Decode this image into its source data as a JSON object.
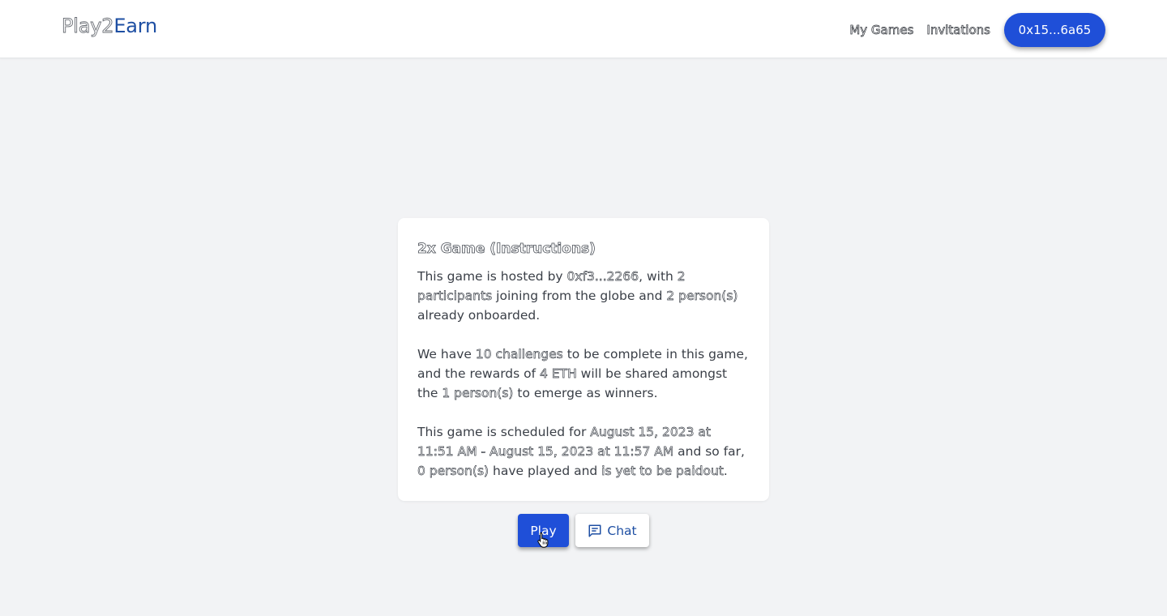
{
  "header": {
    "brand_part1": "Play2",
    "brand_part2": "Earn",
    "nav_links": [
      "My Games",
      "Invitations"
    ],
    "wallet_address": "0x15...6a65"
  },
  "card": {
    "title": "2x Game (Instructions)",
    "p1": {
      "t1": "This game is hosted by ",
      "host": "0xf3...2266",
      "t2": ", with ",
      "participants": "2 participants",
      "t3": " joining from the globe and ",
      "onboarded": "2 person(s)",
      "t4": " already onboarded."
    },
    "p2": {
      "t1": "We have ",
      "challenges": "10 challenges",
      "t2": " to be complete in this game, and the rewards of ",
      "reward": "4 ETH",
      "t3": " will be shared amongst the ",
      "winners": "1 person(s)",
      "t4": " to emerge as winners."
    },
    "p3": {
      "t1": "This game is scheduled for ",
      "schedule": "August 15, 2023 at 11:51 AM - August 15, 2023 at 11:57 AM",
      "t2": " and so far, ",
      "played": "0 person(s)",
      "t3": " have played and ",
      "status": "is yet to be paidout",
      "t4": "."
    }
  },
  "actions": {
    "play_label": "Play",
    "chat_label": "Chat",
    "chat_icon": "chat-icon"
  },
  "colors": {
    "accent": "#1f4fd8",
    "brand": "#1e4fa3",
    "background": "#f2f3f5"
  }
}
